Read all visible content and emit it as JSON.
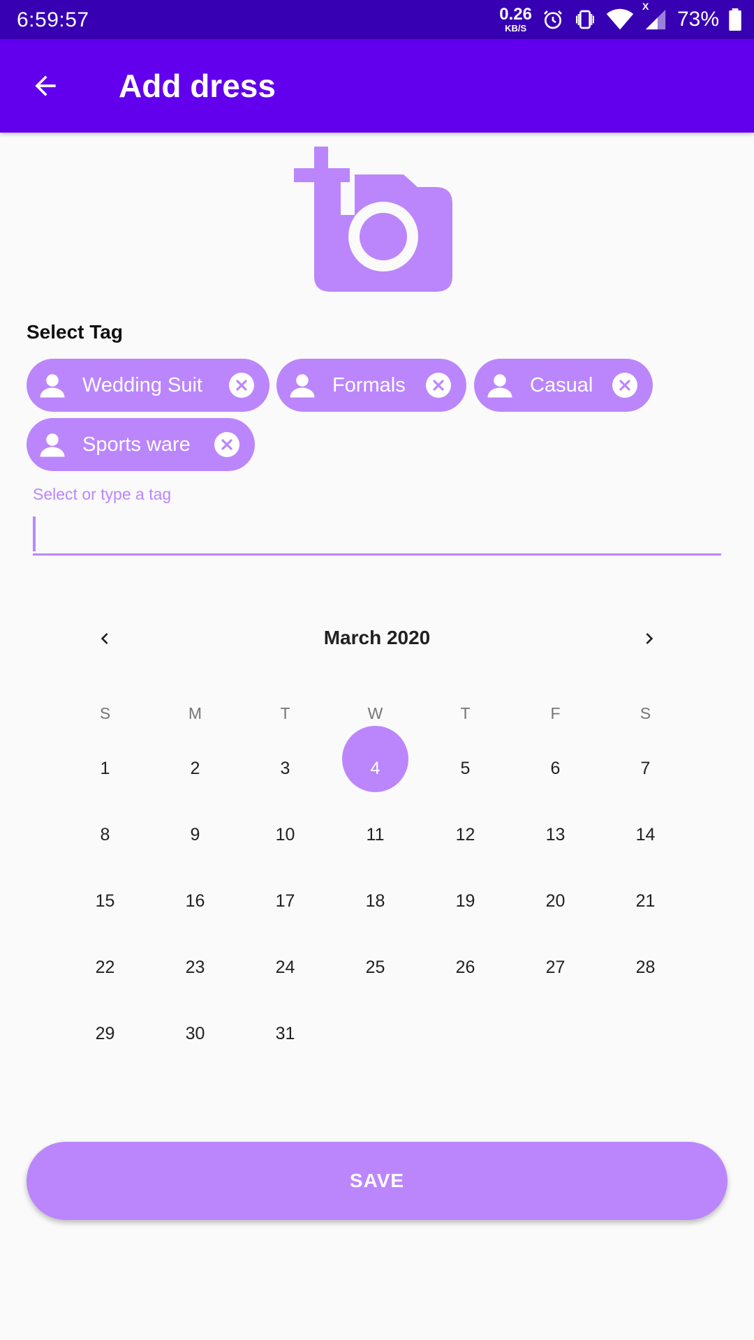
{
  "status_bar": {
    "time": "6:59:57",
    "net_speed_value": "0.26",
    "net_speed_unit": "KB/S",
    "network_label": "X",
    "battery": "73%"
  },
  "app_bar": {
    "title": "Add dress",
    "back_icon": "arrow-left-icon"
  },
  "photo": {
    "icon": "add-a-photo-icon"
  },
  "tags": {
    "label": "Select Tag",
    "chips": [
      {
        "label": "Wedding Suit"
      },
      {
        "label": "Formals"
      },
      {
        "label": "Casual"
      },
      {
        "label": "Sports ware"
      }
    ],
    "input_placeholder": "Select or type a tag",
    "input_value": ""
  },
  "calendar": {
    "month_label": "March 2020",
    "weekdays": [
      "S",
      "M",
      "T",
      "W",
      "T",
      "F",
      "S"
    ],
    "weeks": [
      [
        "1",
        "2",
        "3",
        "4",
        "5",
        "6",
        "7"
      ],
      [
        "8",
        "9",
        "10",
        "11",
        "12",
        "13",
        "14"
      ],
      [
        "15",
        "16",
        "17",
        "18",
        "19",
        "20",
        "21"
      ],
      [
        "22",
        "23",
        "24",
        "25",
        "26",
        "27",
        "28"
      ],
      [
        "29",
        "30",
        "31",
        "",
        "",
        "",
        ""
      ]
    ],
    "selected_day": "4"
  },
  "save_button": {
    "label": "SAVE"
  },
  "colors": {
    "status_bar": "#3700b3",
    "app_bar": "#6200ee",
    "accent": "#bb86fc"
  }
}
